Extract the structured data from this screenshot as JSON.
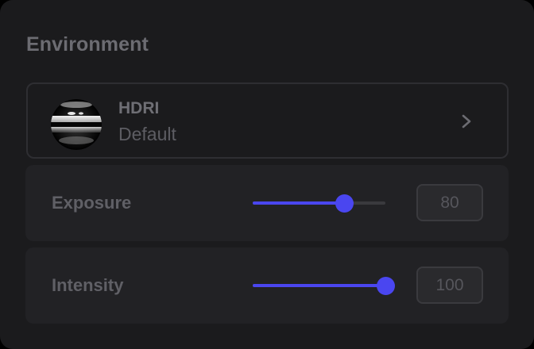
{
  "panel": {
    "title": "Environment"
  },
  "hdri": {
    "label": "HDRI",
    "value": "Default",
    "thumb_icon": "hdri-sphere-icon",
    "chevron_icon": "chevron-right-icon"
  },
  "exposure": {
    "label": "Exposure",
    "value": "80",
    "slider_fraction": 0.69
  },
  "intensity": {
    "label": "Intensity",
    "value": "100",
    "slider_fraction": 1.0
  },
  "colors": {
    "accent": "#4a46f0",
    "panel_bg": "#1b1b1d",
    "row_bg": "#222225",
    "text_muted": "#6c6c72"
  }
}
